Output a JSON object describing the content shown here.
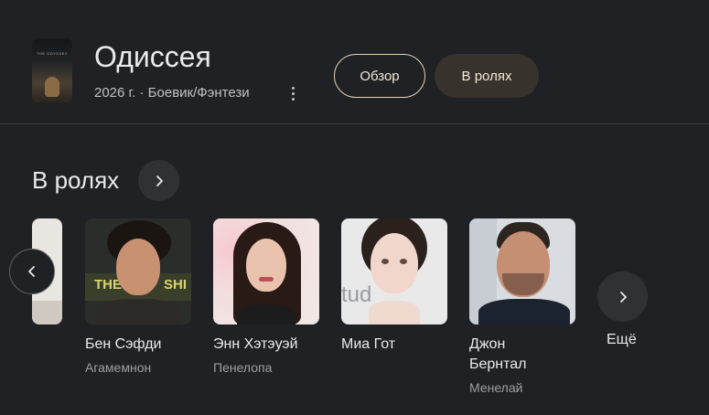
{
  "movie": {
    "title": "Одиссея",
    "meta": "2026 г. · Боевик/Фэнтези",
    "poster_text": "THE ODYSSEY"
  },
  "tabs": [
    {
      "label": "Обзор"
    },
    {
      "label": "В ролях"
    }
  ],
  "section": {
    "title": "В ролях"
  },
  "cast": [
    {
      "name": "Бен Сэфди",
      "role": "Агамемнон"
    },
    {
      "name": "Энн Хэтэуэй",
      "role": "Пенелопа"
    },
    {
      "name": "Миа Гот",
      "role": ""
    },
    {
      "name": "Джон Бернтал",
      "role": "Менелай"
    }
  ],
  "more_label": "Ещё",
  "photo_backdrop_text": [
    "THE",
    "SHI",
    "tud"
  ],
  "colors": {
    "background": "#202124",
    "tab_border": "#e3d6b9",
    "tab_active_bg": "#37332c",
    "secondary_text": "#9aa0a6"
  }
}
